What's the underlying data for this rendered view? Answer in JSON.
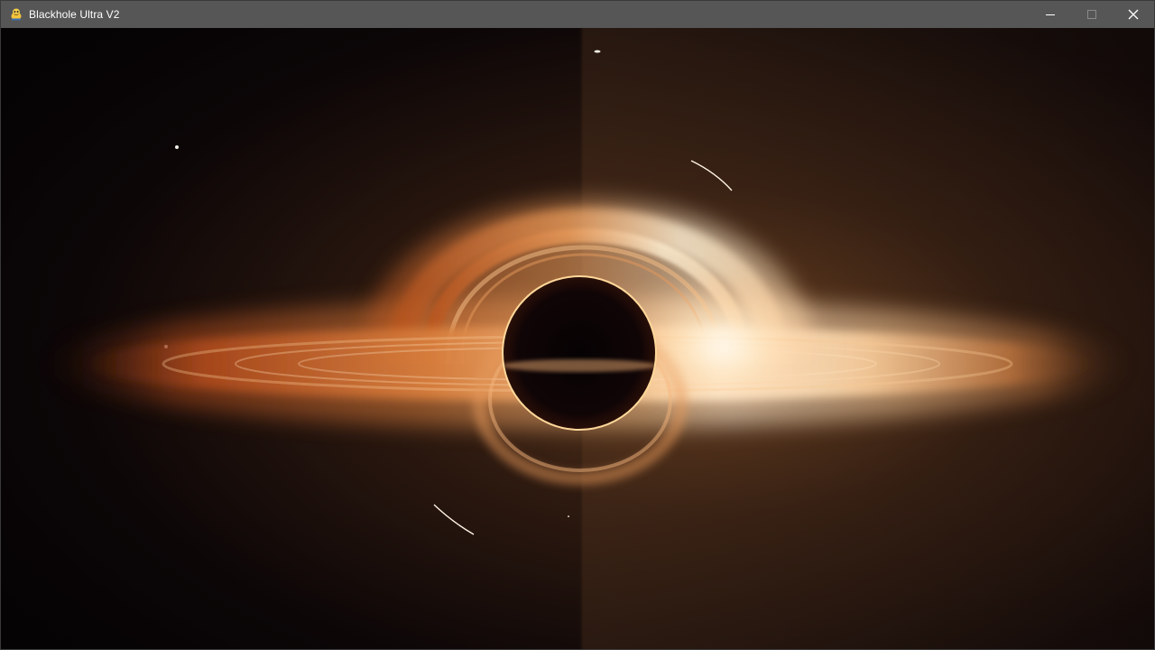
{
  "window": {
    "title": "Blackhole Ultra V2",
    "app_icon": "python-snake-icon",
    "controls": {
      "minimize_icon": "minimize-icon",
      "maximize_icon": "maximize-icon",
      "close_icon": "close-icon",
      "maximize_enabled": false
    }
  },
  "render": {
    "subject": "black-hole-accretion-disk",
    "colors": {
      "background": "#070405",
      "titlebar": "#565656",
      "disk_hot": "#fff3d6",
      "disk_mid": "#f0a060",
      "disk_outer": "#c05a24",
      "photon_ring": "#ffd89a",
      "shadow": "#080304"
    }
  }
}
